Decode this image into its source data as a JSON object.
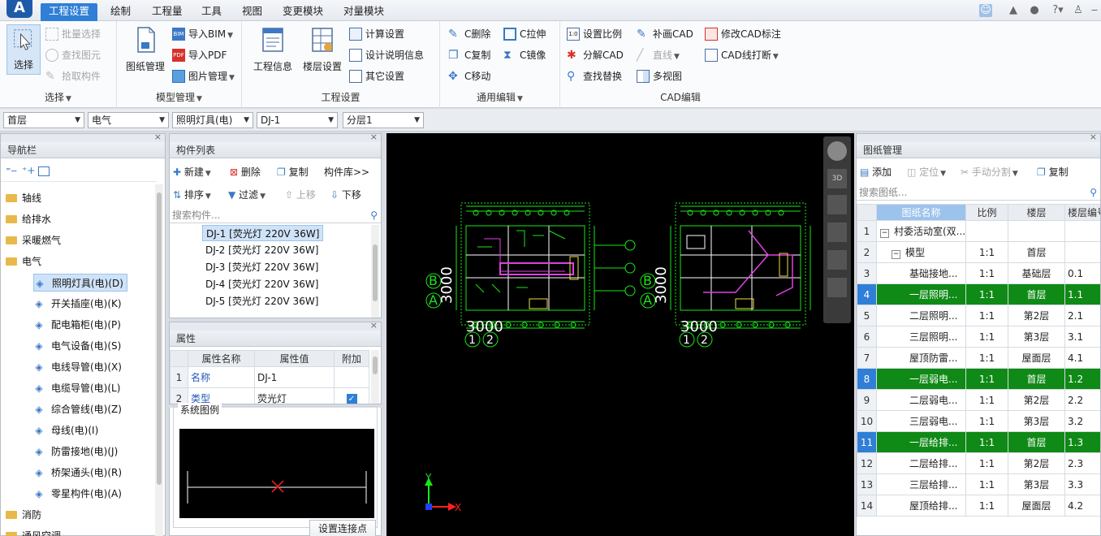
{
  "menu": {
    "logo": "A",
    "tabs": [
      "工程设置",
      "绘制",
      "工程量",
      "工具",
      "视图",
      "变更模块",
      "对量模块"
    ],
    "active": 0
  },
  "ribbon": {
    "select_group": {
      "label": "选择",
      "select_btn": "选择",
      "batch": "批量选择",
      "find": "查找图元",
      "pick": "拾取构件"
    },
    "model_group": {
      "label": "模型管理",
      "drawings": "图纸管理",
      "import_bim": "导入BIM",
      "import_pdf": "导入PDF",
      "image_mgmt": "图片管理"
    },
    "project_group": {
      "label": "工程设置",
      "info": "工程信息",
      "floors": "楼层设置",
      "calc": "计算设置",
      "design_desc": "设计说明信息",
      "other": "其它设置"
    },
    "edit_group": {
      "label": "通用编辑",
      "delete": "C删除",
      "stretch": "C拉伸",
      "copy": "C复制",
      "mirror": "C镜像",
      "move": "C移动"
    },
    "cad_group": {
      "label": "CAD编辑",
      "scale": "设置比例",
      "redraw": "补画CAD",
      "modify_label": "修改CAD标注",
      "explode": "分解CAD",
      "line": "直线",
      "break": "CAD线打断",
      "find_replace": "查找替换",
      "multiview": "多视图"
    }
  },
  "selectors": [
    "首层",
    "电气",
    "照明灯具(电)",
    "DJ-1",
    "分层1"
  ],
  "nav": {
    "title": "导航栏",
    "items": [
      {
        "label": "轴线",
        "kind": "folder"
      },
      {
        "label": "给排水",
        "kind": "folder"
      },
      {
        "label": "采暖燃气",
        "kind": "folder"
      },
      {
        "label": "电气",
        "kind": "folder"
      },
      {
        "label": "照明灯具(电)(D)",
        "kind": "child"
      },
      {
        "label": "开关插座(电)(K)",
        "kind": "child"
      },
      {
        "label": "配电箱柜(电)(P)",
        "kind": "child"
      },
      {
        "label": "电气设备(电)(S)",
        "kind": "child"
      },
      {
        "label": "电线导管(电)(X)",
        "kind": "child"
      },
      {
        "label": "电缆导管(电)(L)",
        "kind": "child"
      },
      {
        "label": "综合管线(电)(Z)",
        "kind": "child"
      },
      {
        "label": "母线(电)(I)",
        "kind": "child"
      },
      {
        "label": "防雷接地(电)(J)",
        "kind": "child"
      },
      {
        "label": "桥架通头(电)(R)",
        "kind": "child"
      },
      {
        "label": "零星构件(电)(A)",
        "kind": "child"
      },
      {
        "label": "消防",
        "kind": "folder"
      },
      {
        "label": "通风空调",
        "kind": "folder"
      }
    ]
  },
  "components": {
    "title": "构件列表",
    "new": "新建",
    "delete": "删除",
    "copy": "复制",
    "library": "构件库>>",
    "sort": "排序",
    "filter": "过滤",
    "up": "上移",
    "down": "下移",
    "search_placeholder": "搜索构件...",
    "items": [
      "DJ-1 [荧光灯 220V 36W]",
      "DJ-2 [荧光灯 220V 36W]",
      "DJ-3 [荧光灯 220V 36W]",
      "DJ-4 [荧光灯 220V 36W]",
      "DJ-5 [荧光灯 220V 36W]"
    ]
  },
  "properties": {
    "title": "属性",
    "headers": [
      "属性名称",
      "属性值",
      "附加"
    ],
    "rows": [
      {
        "n": "1",
        "name": "名称",
        "value": "DJ-1"
      },
      {
        "n": "2",
        "name": "类型",
        "value": "荧光灯"
      }
    ]
  },
  "legend": {
    "title": "系统图例",
    "set_point": "设置连接点"
  },
  "canvas": {
    "dim_left": "3000",
    "dim_right": "3000",
    "grid_b": "B",
    "grid_a": "A",
    "n1": "1",
    "n2": "2",
    "axis_x": "X",
    "axis_y": "Y"
  },
  "drawings": {
    "title": "图纸管理",
    "add": "添加",
    "locate": "定位",
    "split": "手动分割",
    "copy": "复制",
    "search_placeholder": "搜索图纸...",
    "headers": [
      "图纸名称",
      "比例",
      "楼层",
      "楼层编号"
    ],
    "rows": [
      {
        "n": "1",
        "name": "村委活动室(双...",
        "scale": "",
        "floor": "",
        "code": "",
        "level": 0,
        "hl": false
      },
      {
        "n": "2",
        "name": "模型",
        "scale": "1:1",
        "floor": "首层",
        "code": "",
        "level": 1,
        "hl": false
      },
      {
        "n": "3",
        "name": "基础接地...",
        "scale": "1:1",
        "floor": "基础层",
        "code": "0.1",
        "level": 2,
        "hl": false
      },
      {
        "n": "4",
        "name": "一层照明...",
        "scale": "1:1",
        "floor": "首层",
        "code": "1.1",
        "level": 2,
        "hl": true
      },
      {
        "n": "5",
        "name": "二层照明...",
        "scale": "1:1",
        "floor": "第2层",
        "code": "2.1",
        "level": 2,
        "hl": false
      },
      {
        "n": "6",
        "name": "三层照明...",
        "scale": "1:1",
        "floor": "第3层",
        "code": "3.1",
        "level": 2,
        "hl": false
      },
      {
        "n": "7",
        "name": "屋顶防雷...",
        "scale": "1:1",
        "floor": "屋面层",
        "code": "4.1",
        "level": 2,
        "hl": false
      },
      {
        "n": "8",
        "name": "一层弱电...",
        "scale": "1:1",
        "floor": "首层",
        "code": "1.2",
        "level": 2,
        "hl": true
      },
      {
        "n": "9",
        "name": "二层弱电...",
        "scale": "1:1",
        "floor": "第2层",
        "code": "2.2",
        "level": 2,
        "hl": false
      },
      {
        "n": "10",
        "name": "三层弱电...",
        "scale": "1:1",
        "floor": "第3层",
        "code": "3.2",
        "level": 2,
        "hl": false
      },
      {
        "n": "11",
        "name": "一层给排...",
        "scale": "1:1",
        "floor": "首层",
        "code": "1.3",
        "level": 2,
        "hl": true
      },
      {
        "n": "12",
        "name": "二层给排...",
        "scale": "1:1",
        "floor": "第2层",
        "code": "2.3",
        "level": 2,
        "hl": false
      },
      {
        "n": "13",
        "name": "三层给排...",
        "scale": "1:1",
        "floor": "第3层",
        "code": "3.3",
        "level": 2,
        "hl": false
      },
      {
        "n": "14",
        "name": "屋顶给排...",
        "scale": "1:1",
        "floor": "屋面层",
        "code": "4.2",
        "level": 2,
        "hl": false
      }
    ]
  },
  "colors": {
    "accent": "#2f7fd6",
    "highlight_row": "#0f8a16",
    "cad_green": "#19e619",
    "cad_magenta": "#e040e0",
    "cad_yellow": "#f0e040"
  }
}
